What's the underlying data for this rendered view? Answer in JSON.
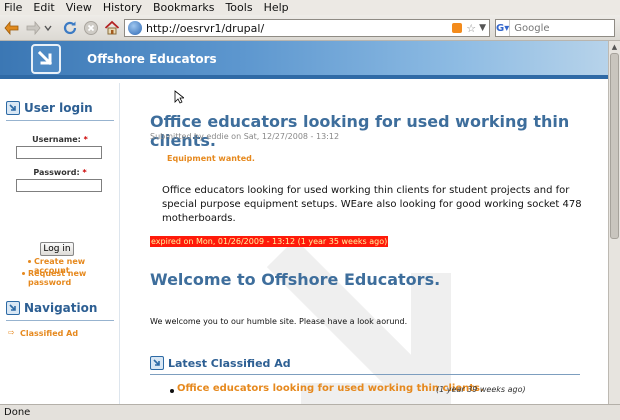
{
  "browser": {
    "menu": [
      "File",
      "Edit",
      "View",
      "History",
      "Bookmarks",
      "Tools",
      "Help"
    ],
    "url": "http://oesrvr1/drupal/",
    "search_placeholder": "Google",
    "search_engine_icon": "google-icon",
    "status": "Done"
  },
  "site": {
    "name": "Offshore Educators"
  },
  "sidebar": {
    "login": {
      "title": "User login",
      "username_label": "Username:",
      "password_label": "Password:",
      "required_mark": "*",
      "login_button": "Log in",
      "links": [
        "Create new account",
        "Request new password"
      ]
    },
    "navigation": {
      "title": "Navigation",
      "items": [
        "Classified Ad"
      ]
    }
  },
  "main": {
    "node_title": "Office educators looking for used working thin clients.",
    "submitted": "Submitted by eddie on Sat, 12/27/2008 - 13:12",
    "category": "Equipment wanted.",
    "body": "Office educators looking for used working thin clients for student projects and for special purpose equipment setups. WEare also looking for good working socket 478 motherboards.",
    "expired": "expired on Mon, 01/26/2009 - 13:12 (1 year 35 weeks ago)",
    "welcome_title": "Welcome to Offshore Educators.",
    "welcome_text": "We welcome you to our humble site. Please have a look aorund.",
    "latest_title": "Latest Classified Ad",
    "latest_items": [
      {
        "title": "Office educators looking for used working thin clients.",
        "age": "(1 year 39 weeks ago)"
      }
    ]
  },
  "colors": {
    "accent_blue": "#3e6e9c",
    "link_orange": "#e6891e",
    "expired_red": "#ff1a0a"
  }
}
